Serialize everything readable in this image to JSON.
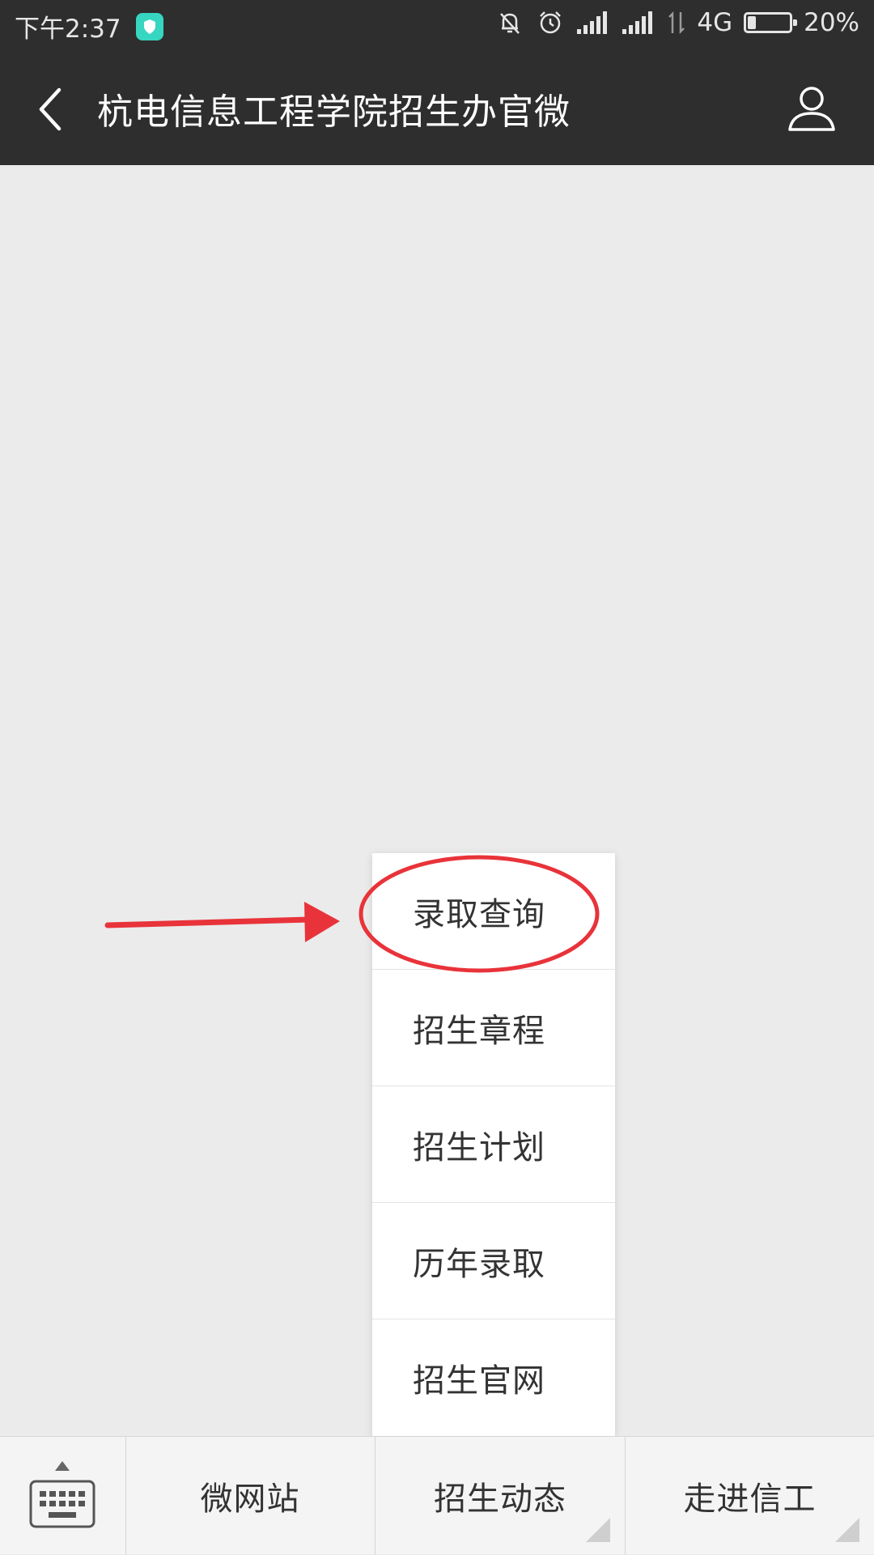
{
  "status_bar": {
    "time": "下午2:37",
    "network": "4G",
    "battery": "20%",
    "battery_level": 0.2
  },
  "header": {
    "title": "杭电信息工程学院招生办官微"
  },
  "popup_menu": {
    "items": [
      {
        "label": "录取查询"
      },
      {
        "label": "招生章程"
      },
      {
        "label": "招生计划"
      },
      {
        "label": "历年录取"
      },
      {
        "label": "招生官网"
      }
    ]
  },
  "bottom_menu": {
    "items": [
      {
        "label": "微网站"
      },
      {
        "label": "招生动态"
      },
      {
        "label": "走进信工"
      }
    ]
  },
  "colors": {
    "header_bg": "#2e2e2e",
    "page_bg": "#ebebeb",
    "annotation": "#e8333a",
    "shield": "#36d6c0"
  },
  "icons": {
    "back": "chevron-left-icon",
    "profile": "person-icon",
    "keyboard": "keyboard-icon"
  }
}
